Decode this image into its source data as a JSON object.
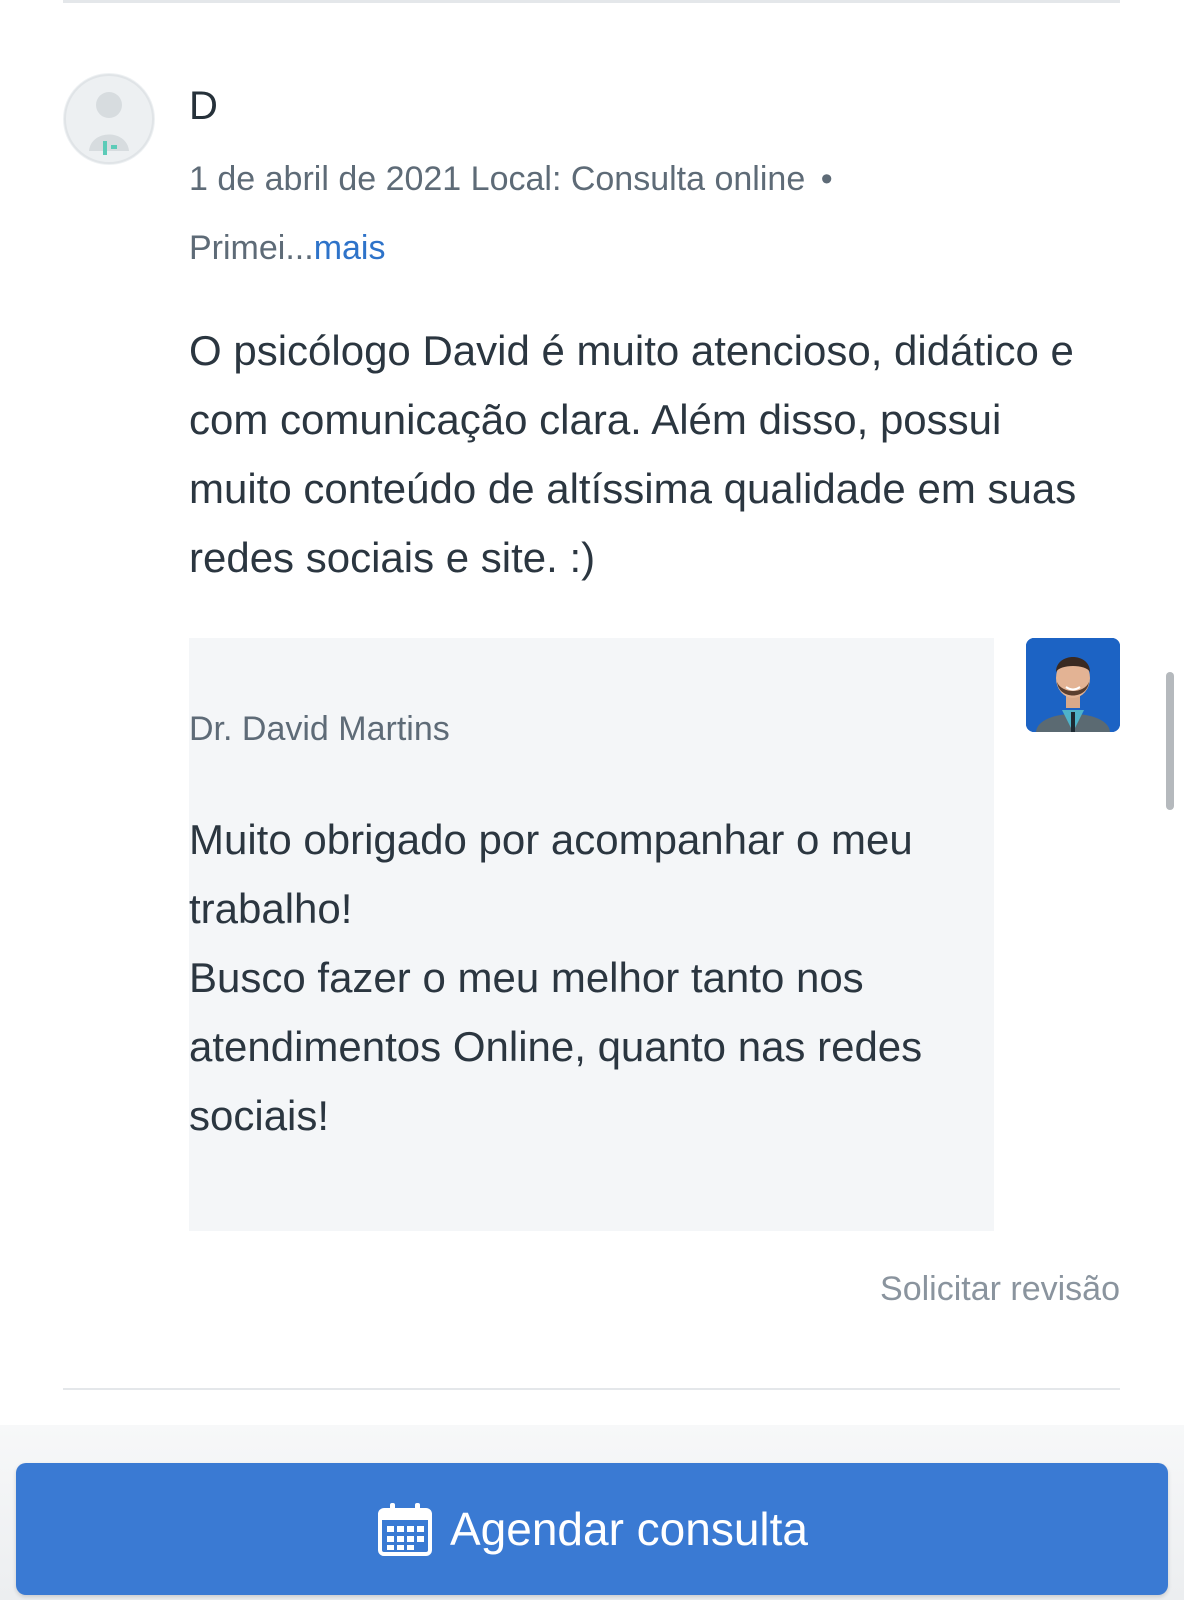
{
  "review": {
    "reviewer_initial": "D",
    "date": "1 de abril de 2021",
    "location": "Local: Consulta online",
    "meta_separator": "•",
    "visit_type_truncated": "Primei...",
    "more_link": "mais",
    "text": "O psicólogo David é muito atencioso, didático e com comunicação clara. Além disso, possui muito conteúdo de altíssima qualidade em suas redes sociais e site. :)"
  },
  "reply": {
    "doctor_name": "Dr. David Martins",
    "text": "Muito obrigado por acompanhar o meu trabalho!\nBusco fazer o meu melhor tanto nos atendimentos Online, quanto nas redes sociais!"
  },
  "actions": {
    "request_review": "Solicitar revisão",
    "book_appointment": "Agendar consulta"
  },
  "icons": {
    "user_avatar": "default-user-avatar-icon",
    "doctor_avatar": "doctor-photo",
    "calendar": "calendar-icon"
  },
  "colors": {
    "link": "#2e73c9",
    "primary_button": "#3a7ad3",
    "reply_background": "#f4f6f8",
    "muted_text": "#5e6b77"
  }
}
